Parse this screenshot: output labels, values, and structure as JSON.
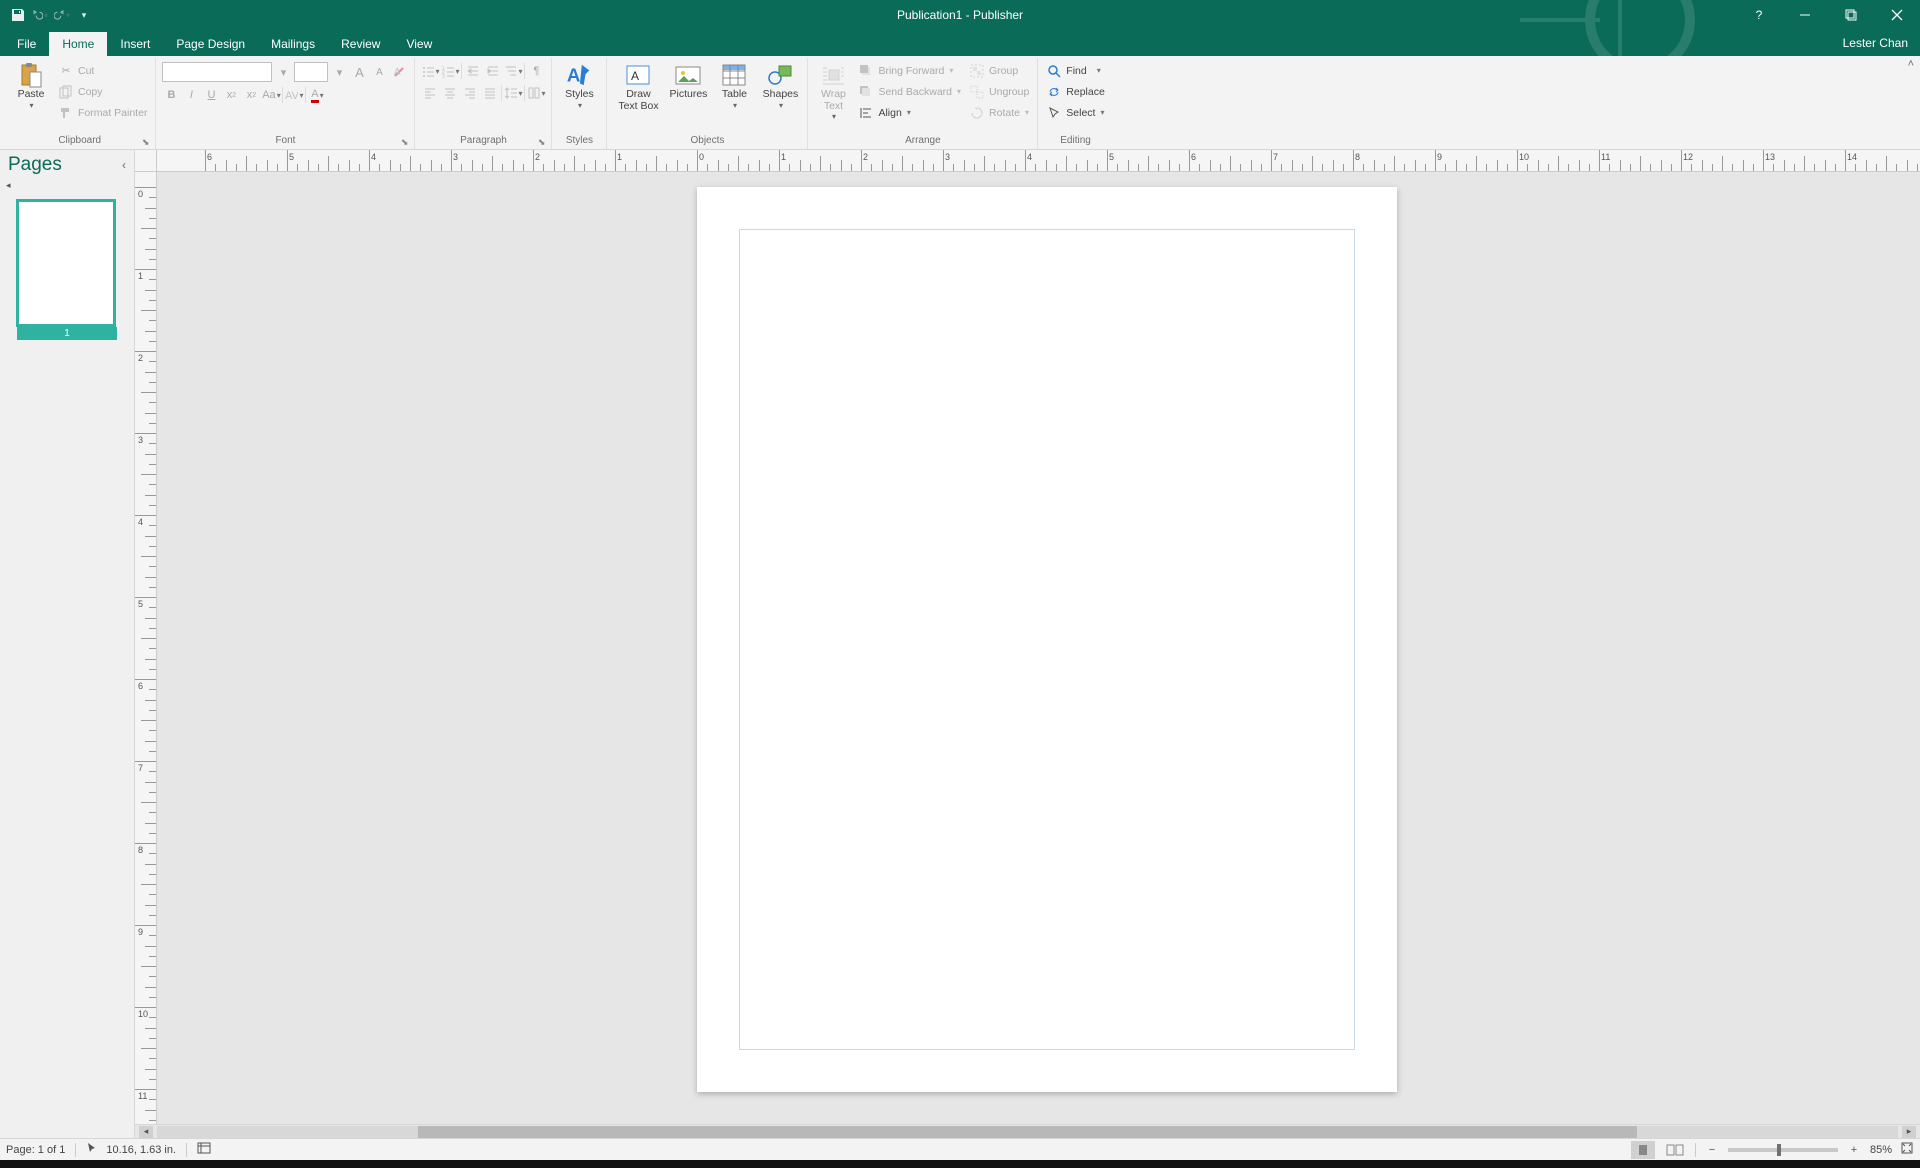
{
  "titlebar": {
    "doc_title": "Publication1 - Publisher"
  },
  "menubar": {
    "tabs": [
      "File",
      "Home",
      "Insert",
      "Page Design",
      "Mailings",
      "Review",
      "View"
    ],
    "active": 1,
    "user": "Lester Chan"
  },
  "ribbon": {
    "clipboard": {
      "paste": "Paste",
      "cut": "Cut",
      "copy": "Copy",
      "format_painter": "Format Painter",
      "label": "Clipboard"
    },
    "font": {
      "label": "Font",
      "grow": "A",
      "shrink": "A",
      "bold": "B",
      "italic": "I",
      "underline": "U"
    },
    "paragraph": {
      "label": "Paragraph"
    },
    "styles": {
      "styles": "Styles",
      "label": "Styles"
    },
    "objects": {
      "draw_text_box": "Draw\nText Box",
      "pictures": "Pictures",
      "table": "Table",
      "shapes": "Shapes",
      "label": "Objects"
    },
    "arrange": {
      "wrap_text": "Wrap\nText",
      "bring_forward": "Bring Forward",
      "send_backward": "Send Backward",
      "group": "Group",
      "ungroup": "Ungroup",
      "align": "Align",
      "rotate": "Rotate",
      "label": "Arrange"
    },
    "editing": {
      "find": "Find",
      "replace": "Replace",
      "select": "Select",
      "label": "Editing"
    }
  },
  "pages_panel": {
    "title": "Pages",
    "thumb_num": "1"
  },
  "statusbar": {
    "page": "Page: 1 of 1",
    "coords": "10.16, 1.63 in.",
    "zoom": "85%"
  }
}
